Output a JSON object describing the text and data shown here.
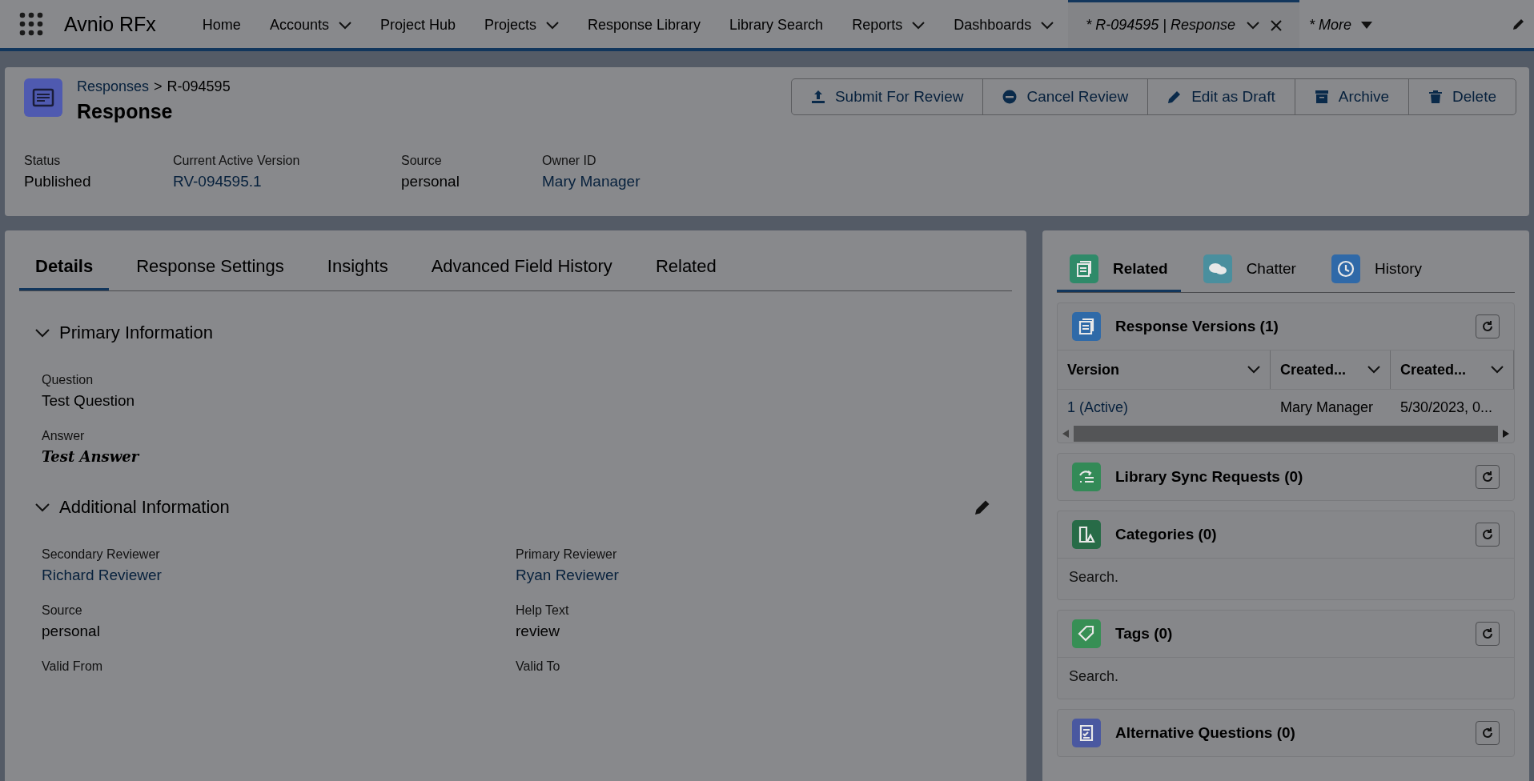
{
  "app": {
    "name": "Avnio RFx"
  },
  "nav": [
    {
      "label": "Home",
      "kind": "tab",
      "has_menu": false,
      "selected": false,
      "italic": false,
      "closable": false
    },
    {
      "label": "Accounts",
      "kind": "tab",
      "has_menu": true,
      "selected": false,
      "italic": false,
      "closable": false
    },
    {
      "label": "Project Hub",
      "kind": "tab",
      "has_menu": false,
      "selected": false,
      "italic": false,
      "closable": false
    },
    {
      "label": "Projects",
      "kind": "tab",
      "has_menu": true,
      "selected": false,
      "italic": false,
      "closable": false
    },
    {
      "label": "Response Library",
      "kind": "tab",
      "has_menu": false,
      "selected": false,
      "italic": false,
      "closable": false
    },
    {
      "label": "Library Search",
      "kind": "tab",
      "has_menu": false,
      "selected": false,
      "italic": false,
      "closable": false
    },
    {
      "label": "Reports",
      "kind": "tab",
      "has_menu": true,
      "selected": false,
      "italic": false,
      "closable": false
    },
    {
      "label": "Dashboards",
      "kind": "tab",
      "has_menu": true,
      "selected": false,
      "italic": false,
      "closable": false
    },
    {
      "label": "* R-094595 | Response",
      "kind": "tab",
      "has_menu": true,
      "selected": true,
      "italic": true,
      "closable": true
    },
    {
      "label": "* More",
      "kind": "more",
      "has_menu": true,
      "selected": false,
      "italic": true,
      "closable": false
    }
  ],
  "header": {
    "breadcrumb": "Responses",
    "separator": ">",
    "record_id": "R-094595",
    "title": "Response",
    "actions": [
      {
        "label": "Submit For Review",
        "kind": "submit"
      },
      {
        "label": "Cancel Review",
        "kind": "cancel"
      },
      {
        "label": "Edit as Draft",
        "kind": "edit"
      },
      {
        "label": "Archive",
        "kind": "archive"
      },
      {
        "label": "Delete",
        "kind": "delete"
      }
    ],
    "fields": [
      {
        "label": "Status",
        "value": "Published",
        "kind": "text"
      },
      {
        "label": "Current Active Version",
        "value": "RV-094595.1",
        "kind": "link"
      },
      {
        "label": "Source",
        "value": "personal",
        "kind": "text"
      },
      {
        "label": "Owner ID",
        "value": "Mary Manager",
        "kind": "link"
      }
    ]
  },
  "tabs": [
    {
      "label": "Details",
      "selected": true
    },
    {
      "label": "Response Settings",
      "selected": false
    },
    {
      "label": "Insights",
      "selected": false
    },
    {
      "label": "Advanced Field History",
      "selected": false
    },
    {
      "label": "Related",
      "selected": false
    }
  ],
  "sections": [
    {
      "title": "Primary Information",
      "expanded": true,
      "editable": false,
      "fields": [
        {
          "label": "Question",
          "value": "Test Question",
          "kind": "text"
        },
        {
          "label": "Answer",
          "value": "Test Answer",
          "kind": "rich"
        }
      ]
    },
    {
      "title": "Additional Information",
      "expanded": true,
      "editable": true,
      "fields": [
        {
          "label": "Secondary Reviewer",
          "value": "Richard Reviewer",
          "kind": "link"
        },
        {
          "label": "Primary Reviewer",
          "value": "Ryan Reviewer",
          "kind": "link"
        },
        {
          "label": "Source",
          "value": "personal",
          "kind": "text"
        },
        {
          "label": "Help Text",
          "value": "review",
          "kind": "text"
        },
        {
          "label": "Valid From"
        },
        {
          "label": "Valid To"
        }
      ]
    }
  ],
  "side_tabs": [
    {
      "label": "Related",
      "selected": true,
      "kind": "related",
      "color": "#2f8a69"
    },
    {
      "label": "Chatter",
      "selected": false,
      "kind": "chatter",
      "color": "#4a8f9e"
    },
    {
      "label": "History",
      "selected": false,
      "kind": "history",
      "color": "#2f69a8"
    }
  ],
  "cards": [
    {
      "title": "Response Versions (1)",
      "kind": "table",
      "color": "#2f6aa8",
      "columns": [
        "Version",
        "Created...",
        "Created..."
      ],
      "rows": [
        [
          {
            "text": "1 (Active)",
            "kind": "link"
          },
          {
            "text": "Mary Manager",
            "kind": "text"
          },
          {
            "text": "5/30/2023, 0...",
            "kind": "text"
          }
        ]
      ]
    },
    {
      "title": "Library Sync Requests (0)",
      "kind": "plain",
      "color": "#338a57"
    },
    {
      "title": "Categories (0)",
      "kind": "search",
      "color": "#276b47",
      "placeholder": "Search."
    },
    {
      "title": "Tags (0)",
      "kind": "search",
      "color": "#378f55",
      "placeholder": "Search."
    },
    {
      "title": "Alternative Questions (0)",
      "kind": "plain",
      "color": "#4a58a0"
    }
  ]
}
